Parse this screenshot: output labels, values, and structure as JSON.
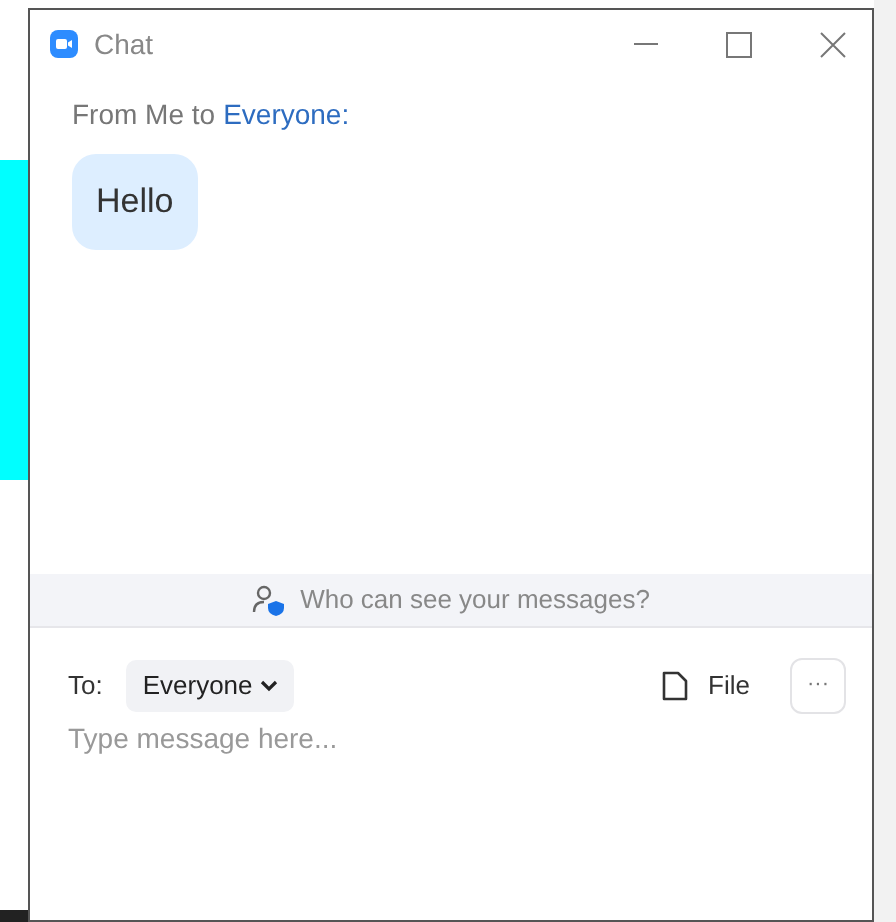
{
  "window": {
    "title": "Chat"
  },
  "messages": [
    {
      "sender": "From Me to",
      "recipient": "Everyone:",
      "text": "Hello"
    }
  ],
  "privacy_notice": "Who can see your messages?",
  "composer": {
    "to_label": "To:",
    "recipient": "Everyone",
    "file_label": "File",
    "more": "···",
    "placeholder": "Type message here..."
  }
}
